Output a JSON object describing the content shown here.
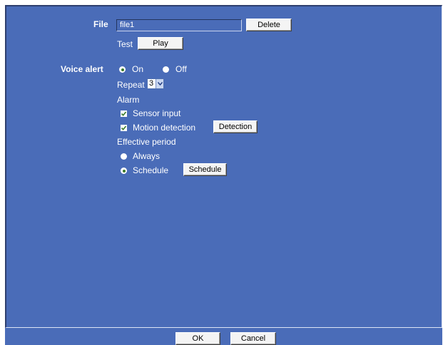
{
  "file": {
    "label": "File",
    "filename_value": "file1",
    "delete_label": "Delete",
    "test_label": "Test",
    "play_label": "Play"
  },
  "voice_alert": {
    "label": "Voice alert",
    "on_label": "On",
    "off_label": "Off",
    "selected": "On",
    "repeat_label": "Repeat",
    "repeat_value": "3",
    "alarm_label": "Alarm",
    "sensor_input_label": "Sensor input",
    "sensor_input_checked": true,
    "motion_detection_label": "Motion detection",
    "motion_detection_checked": true,
    "detection_button_label": "Detection",
    "effective_period_label": "Effective period",
    "always_label": "Always",
    "schedule_label": "Schedule",
    "period_selected": "Schedule",
    "schedule_button_label": "Schedule"
  },
  "footer": {
    "ok_label": "OK",
    "cancel_label": "Cancel"
  },
  "colors": {
    "panel_bg": "#4a6cb8",
    "radio_dot": "#3a7a2a",
    "check_mark": "#3a7a2a"
  },
  "icons": {
    "select_arrow": "chevron-down-icon",
    "check": "checkmark-icon"
  }
}
